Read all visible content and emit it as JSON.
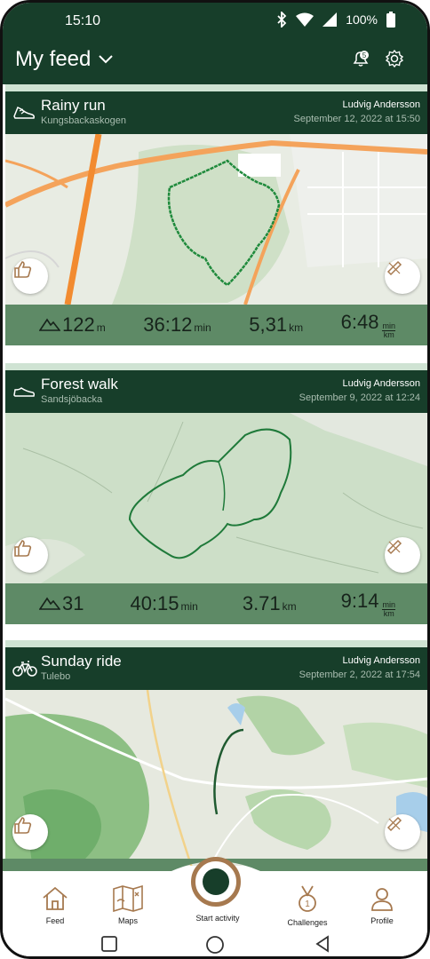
{
  "status_bar": {
    "time": "15:10",
    "battery": "100%",
    "icons": [
      "bluetooth-icon",
      "wifi-icon",
      "signal-icon",
      "battery-icon"
    ]
  },
  "header": {
    "title": "My feed",
    "icons": [
      "chevron-down-icon",
      "notifications-icon",
      "settings-icon"
    ],
    "notification_count": "5"
  },
  "feed": {
    "activities": [
      {
        "sport": "running-shoe-icon",
        "title": "Rainy run",
        "location": "Kungsbackaskogen",
        "author": "Ludvig Andersson",
        "date": "September 12, 2022 at 15:50",
        "stats": {
          "elevation": "122",
          "elevation_unit": "m",
          "duration": "36:12",
          "duration_unit": "min",
          "distance": "5,31",
          "distance_unit": "km",
          "pace": "6:48",
          "pace_unit_top": "min",
          "pace_unit_bottom": "km"
        }
      },
      {
        "sport": "walking-shoe-icon",
        "title": "Forest walk",
        "location": "Sandsjöbacka",
        "author": "Ludvig Andersson",
        "date": "September 9, 2022 at 12:24",
        "stats": {
          "elevation": "31",
          "elevation_unit": "",
          "duration": "40:15",
          "duration_unit": "min",
          "distance": "3.71",
          "distance_unit": "km",
          "pace": "9:14",
          "pace_unit_top": "min",
          "pace_unit_bottom": "km"
        }
      },
      {
        "sport": "bicycle-icon",
        "title": "Sunday ride",
        "location": "Tulebo",
        "author": "Ludvig Andersson",
        "date": "September 2, 2022 at 17:54"
      }
    ]
  },
  "bottom_nav": {
    "items": [
      {
        "label": "Feed",
        "icon": "home-icon"
      },
      {
        "label": "Maps",
        "icon": "map-icon"
      },
      {
        "label": "Start activity",
        "icon": "record-icon"
      },
      {
        "label": "Challenges",
        "icon": "medal-icon",
        "badge": "1"
      },
      {
        "label": "Profile",
        "icon": "profile-icon"
      }
    ]
  },
  "colors": {
    "header_bg": "#173e2a",
    "stats_bg": "#5e8a66",
    "route": "#1f7a3a",
    "accent_bronze": "#a6794f"
  }
}
